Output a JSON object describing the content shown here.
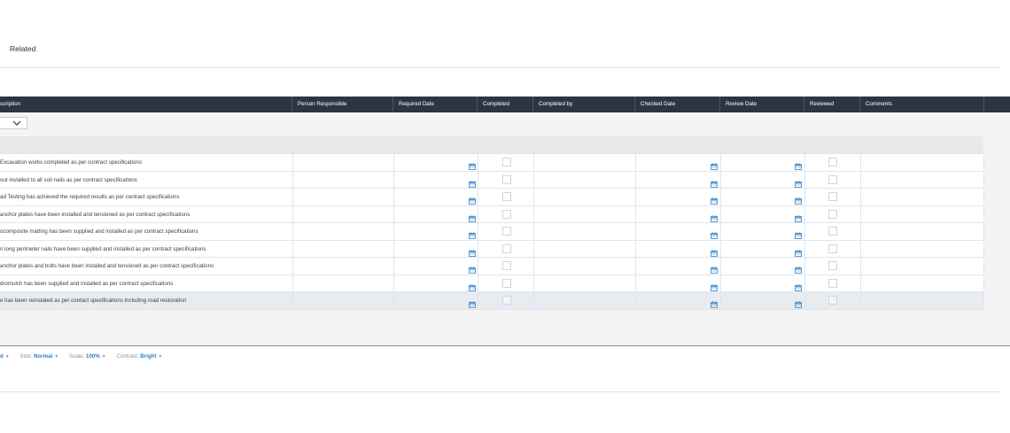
{
  "tabs": {
    "related": "Related"
  },
  "columns": [
    "scription",
    "Person Responsible",
    "Required Date",
    "Completed",
    "Completed by",
    "Checked Date",
    "Review Date",
    "Reviewed",
    "Comments"
  ],
  "rows": [
    "Excavation works completed as per contract specifications",
    "out installed to all soil nails as per contract specifications",
    "ad Testing has achieved the required results as per contract specifications",
    "anchor plates have been installed and tensioned as per contract specifications",
    "ocomposite matting has been supplied and installed as per contract specifications",
    "n long perimeter nails have been supplied and installed as per contract specifications",
    "anchor plates and bolts have been installed and tensioned as per contract specifications",
    "dromulch has been supplied and installed as per contract specifications",
    "e has been reinstated as per contact specifications including road restoration"
  ],
  "selected_row": 8,
  "footer": {
    "first_value": "d",
    "size_label": "Size:",
    "size_value": "Normal",
    "scale_label": "Scale:",
    "scale_value": "100%",
    "contrast_label": "Contrast:",
    "contrast_value": "Bright"
  },
  "colors": {
    "header_bg": "#2d3544",
    "accent": "#2f7dc1",
    "calendar_icon": "#5b9bd5",
    "selected_row_bg": "#e8ebf0"
  },
  "icons": [
    "chevron-down-icon",
    "calendar-icon"
  ]
}
